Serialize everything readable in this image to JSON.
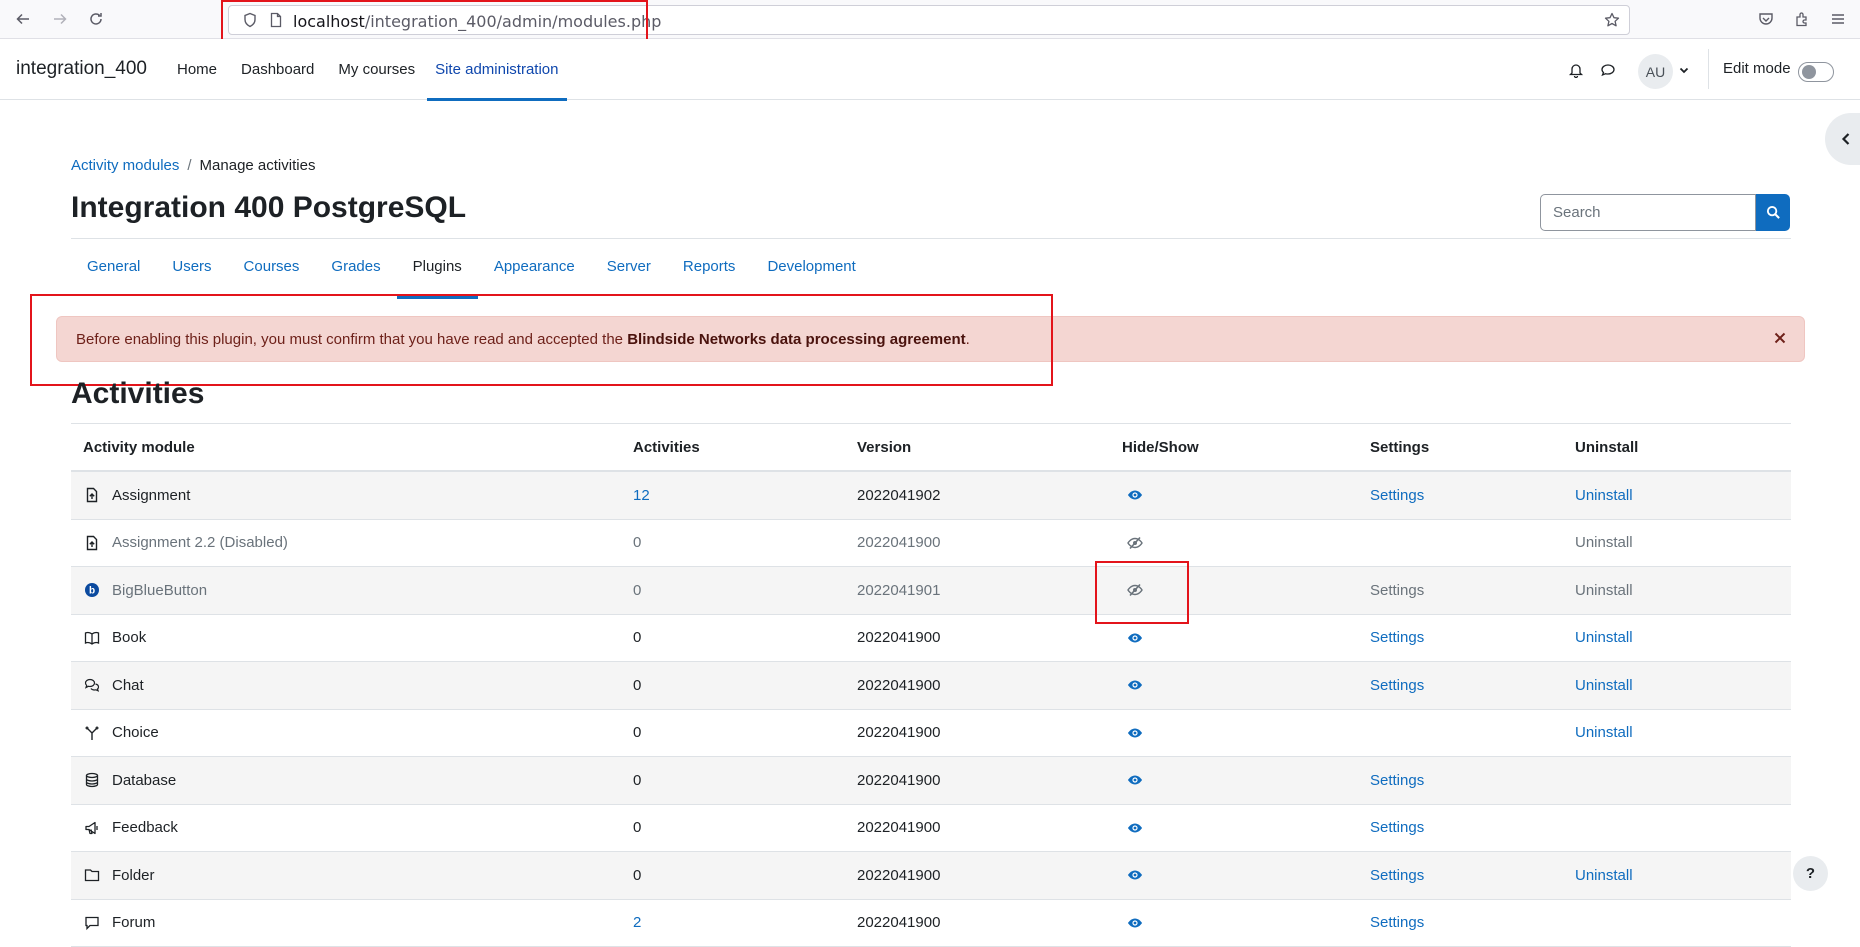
{
  "browser": {
    "url_host": "localhost",
    "url_path": "/integration_400/admin/modules.php"
  },
  "navbar": {
    "site_name": "integration_400",
    "items": [
      {
        "label": "Home"
      },
      {
        "label": "Dashboard"
      },
      {
        "label": "My courses"
      },
      {
        "label": "Site administration",
        "active": true
      }
    ],
    "avatar_initials": "AU",
    "edit_mode_label": "Edit mode",
    "edit_mode_on": false
  },
  "breadcrumb": {
    "parent": "Activity modules",
    "separator": "/",
    "current": "Manage activities"
  },
  "page": {
    "title": "Integration 400 PostgreSQL",
    "search_placeholder": "Search"
  },
  "tabs": [
    {
      "label": "General"
    },
    {
      "label": "Users"
    },
    {
      "label": "Courses"
    },
    {
      "label": "Grades"
    },
    {
      "label": "Plugins",
      "active": true
    },
    {
      "label": "Appearance"
    },
    {
      "label": "Server"
    },
    {
      "label": "Reports"
    },
    {
      "label": "Development"
    }
  ],
  "alert": {
    "text_before": "Before enabling this plugin, you must confirm that you have read and accepted the ",
    "bold_text": "Blindside Networks data processing agreement",
    "text_after": "."
  },
  "section": {
    "title": "Activities"
  },
  "table": {
    "headers": [
      "Activity module",
      "Activities",
      "Version",
      "Hide/Show",
      "Settings",
      "Uninstall"
    ],
    "rows": [
      {
        "name": "Assignment",
        "icon": "assignment-icon",
        "activities": "12",
        "version": "2022041902",
        "visible": true,
        "settings": "Settings",
        "uninstall": "Uninstall"
      },
      {
        "name": "Assignment 2.2 (Disabled)",
        "icon": "assignment-icon",
        "activities": "0",
        "version": "2022041900",
        "visible": false,
        "settings": "",
        "uninstall": "Uninstall"
      },
      {
        "name": "BigBlueButton",
        "icon": "bigbluebutton-icon",
        "activities": "0",
        "version": "2022041901",
        "visible": false,
        "settings": "Settings",
        "uninstall": "Uninstall"
      },
      {
        "name": "Book",
        "icon": "book-icon",
        "activities": "0",
        "version": "2022041900",
        "visible": true,
        "settings": "Settings",
        "uninstall": "Uninstall"
      },
      {
        "name": "Chat",
        "icon": "chat-icon",
        "activities": "0",
        "version": "2022041900",
        "visible": true,
        "settings": "Settings",
        "uninstall": "Uninstall"
      },
      {
        "name": "Choice",
        "icon": "choice-icon",
        "activities": "0",
        "version": "2022041900",
        "visible": true,
        "settings": "",
        "uninstall": "Uninstall"
      },
      {
        "name": "Database",
        "icon": "database-icon",
        "activities": "0",
        "version": "2022041900",
        "visible": true,
        "settings": "Settings",
        "uninstall": ""
      },
      {
        "name": "Feedback",
        "icon": "feedback-icon",
        "activities": "0",
        "version": "2022041900",
        "visible": true,
        "settings": "Settings",
        "uninstall": ""
      },
      {
        "name": "Folder",
        "icon": "folder-icon",
        "activities": "0",
        "version": "2022041900",
        "visible": true,
        "settings": "Settings",
        "uninstall": "Uninstall"
      },
      {
        "name": "Forum",
        "icon": "forum-icon",
        "activities": "2",
        "version": "2022041900",
        "visible": true,
        "settings": "Settings",
        "uninstall": ""
      }
    ]
  },
  "help_button": "?",
  "colors": {
    "primary": "#0f6cbf",
    "alert_bg": "#f4d6d2",
    "alert_text": "#6e211a",
    "annotation_red": "#e3141b"
  }
}
